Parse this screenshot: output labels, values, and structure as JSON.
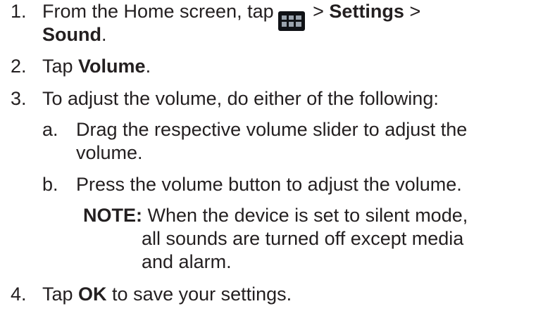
{
  "steps": [
    {
      "number": "1.",
      "parts": {
        "a": "From the Home screen, tap",
        "b": " > ",
        "c": "Settings",
        "d": " >",
        "e": "Sound",
        "f": "."
      },
      "icon": "app-drawer-grid-icon"
    },
    {
      "number": "2.",
      "parts": {
        "a": "Tap ",
        "b": "Volume",
        "c": "."
      }
    },
    {
      "number": "3.",
      "text": "To adjust the volume, do either of the following:",
      "substeps": [
        {
          "letter": "a.",
          "line1": "Drag the respective volume slider to adjust the",
          "line2": "volume."
        },
        {
          "letter": "b.",
          "text": "Press the volume button to adjust the volume."
        }
      ],
      "note": {
        "label": "NOTE:",
        "line1": " When the device is set to silent mode,",
        "line2": "all sounds are turned off except media",
        "line3": "and alarm."
      }
    },
    {
      "number": "4.",
      "parts": {
        "a": "Tap ",
        "b": "OK",
        "c": " to save your settings."
      }
    }
  ]
}
